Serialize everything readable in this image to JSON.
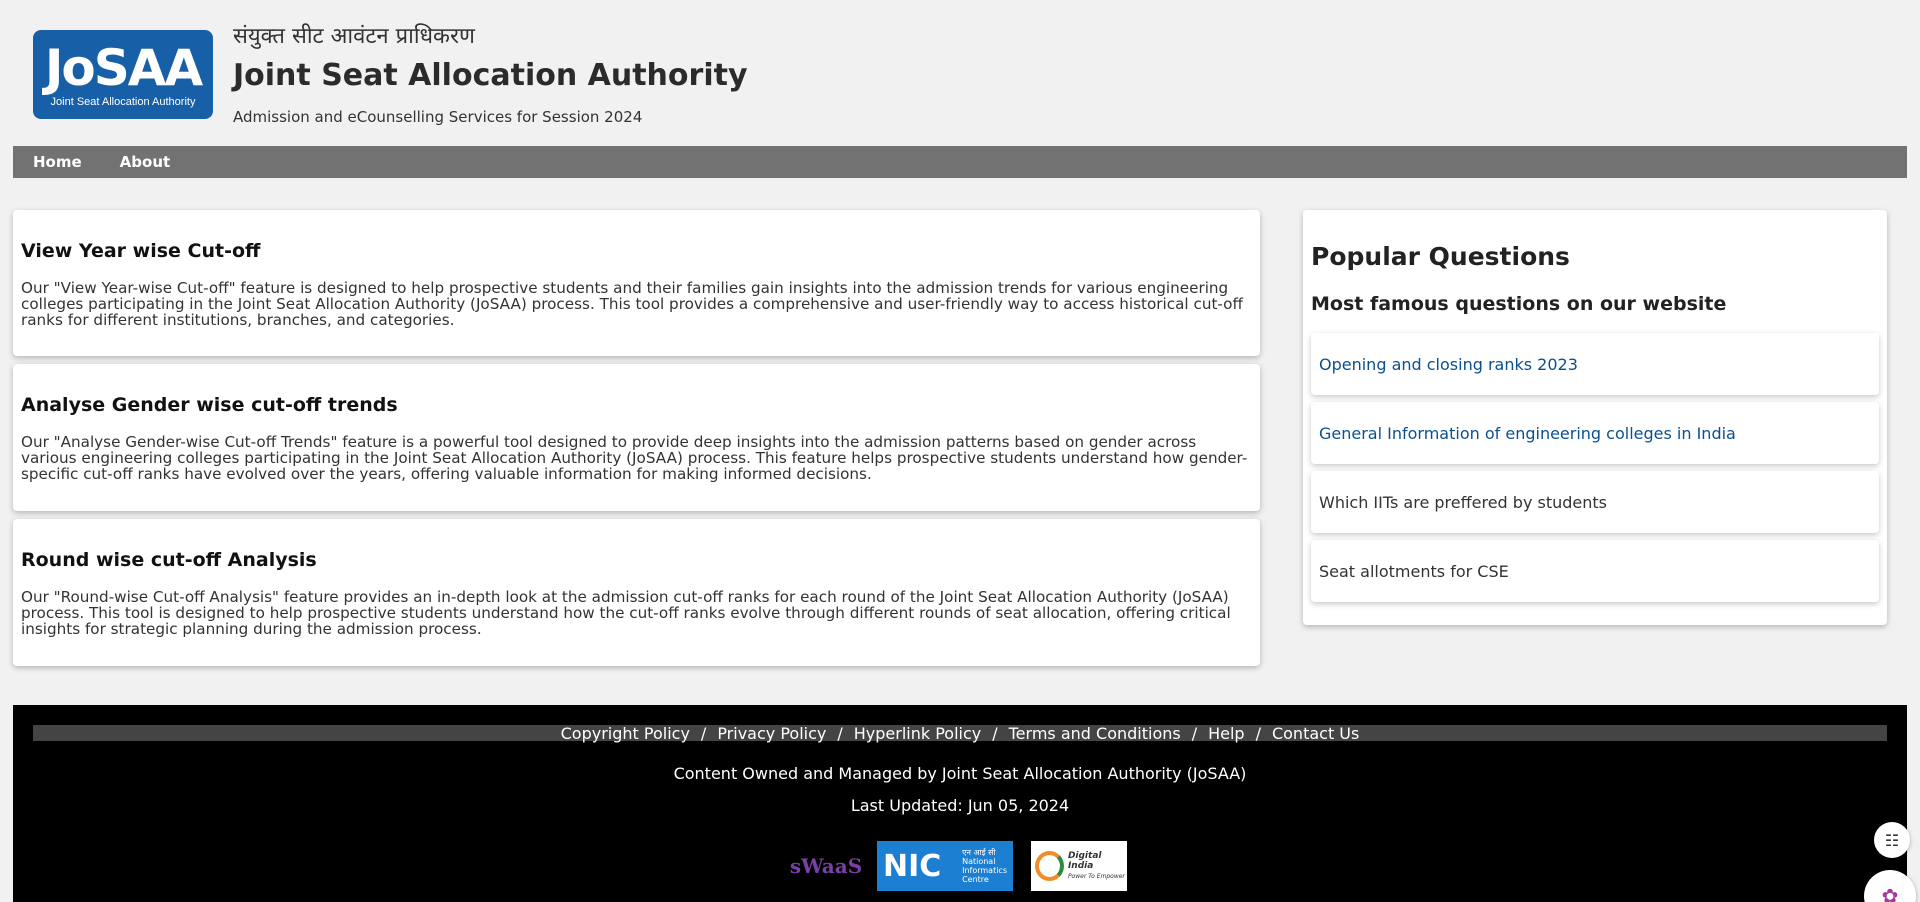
{
  "header": {
    "logo_word": "JoSAA",
    "logo_sub": "Joint Seat Allocation Authority",
    "hindi_title": "संयुक्त सीट आवंटन प्राधिकरण",
    "title": "Joint Seat Allocation Authority",
    "subtitle": "Admission and eCounselling Services for Session 2024"
  },
  "nav": {
    "items": [
      {
        "label": "Home"
      },
      {
        "label": "About"
      }
    ]
  },
  "features": [
    {
      "title": "View Year wise Cut-off",
      "text": "Our \"View Year-wise Cut-off\" feature is designed to help prospective students and their families gain insights into the admission trends for various engineering colleges participating in the Joint Seat Allocation Authority (JoSAA) process. This tool provides a comprehensive and user-friendly way to access historical cut-off ranks for different institutions, branches, and categories."
    },
    {
      "title": "Analyse Gender wise cut-off trends",
      "text": "Our \"Analyse Gender-wise Cut-off Trends\" feature is a powerful tool designed to provide deep insights into the admission patterns based on gender across various engineering colleges participating in the Joint Seat Allocation Authority (JoSAA) process. This feature helps prospective students understand how gender-specific cut-off ranks have evolved over the years, offering valuable information for making informed decisions."
    },
    {
      "title": "Round wise cut-off Analysis",
      "text": "Our \"Round-wise Cut-off Analysis\" feature provides an in-depth look at the admission cut-off ranks for each round of the Joint Seat Allocation Authority (JoSAA) process. This tool is designed to help prospective students understand how the cut-off ranks evolve through different rounds of seat allocation, offering critical insights for strategic planning during the admission process."
    }
  ],
  "sidebar": {
    "title": "Popular Questions",
    "subtitle": "Most famous questions on our website",
    "questions": [
      {
        "label": "Opening and closing ranks 2023"
      },
      {
        "label": "General Information of engineering colleges in India"
      },
      {
        "label": "Which IITs are preffered by students"
      },
      {
        "label": "Seat allotments for CSE"
      }
    ]
  },
  "footer": {
    "links": [
      "Copyright Policy",
      "Privacy Policy",
      "Hyperlink Policy",
      "Terms and Conditions",
      "Help",
      "Contact Us"
    ],
    "separator": "/",
    "owned": "Content Owned and Managed by Joint Seat Allocation Authority (JoSAA)",
    "updated": "Last Updated: Jun 05, 2024",
    "partners": {
      "swaas": "sWaaS",
      "nic_word": "NIC",
      "nic_hindi": "एन आई सी",
      "nic_lines": [
        "National",
        "Informatics",
        "Centre"
      ],
      "digital_india": "Digital India",
      "digital_india_tag": "Power To Empower"
    }
  },
  "colors": {
    "brand_blue": "#1760a8",
    "nav_gray": "#727272",
    "link_blue": "#0b4f90",
    "footer_bg": "#000000"
  },
  "icons": [
    "book-reader-icon",
    "brain-assistant-icon"
  ]
}
